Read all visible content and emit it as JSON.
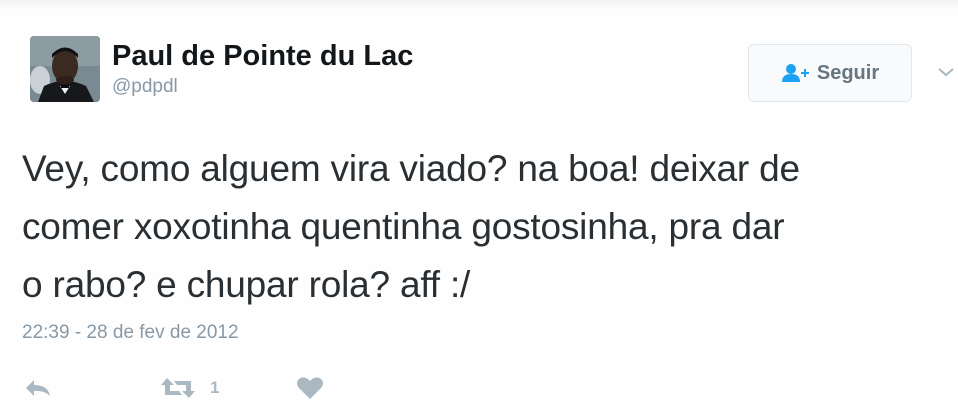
{
  "author": {
    "name": "Paul de Pointe du Lac",
    "handle": "@pdpdl",
    "avatar_icon": "user-avatar-photo"
  },
  "follow_button": {
    "label": "Seguir",
    "icon": "add-user-icon",
    "color": "#66757f"
  },
  "menu": {
    "icon": "chevron-down-icon"
  },
  "tweet": {
    "lines": [
      "Vey, como alguem vira viado? na boa! deixar de",
      "comer xoxotinha quentinha gostosinha, pra dar",
      "o rabo? e chupar rola? aff :/"
    ],
    "timestamp": "22:39 - 28 de fev de 2012"
  },
  "actions": {
    "reply_icon": "reply-icon",
    "retweet_icon": "retweet-icon",
    "retweet_count": "1",
    "like_icon": "heart-icon",
    "icon_color": "#aab8c2"
  }
}
